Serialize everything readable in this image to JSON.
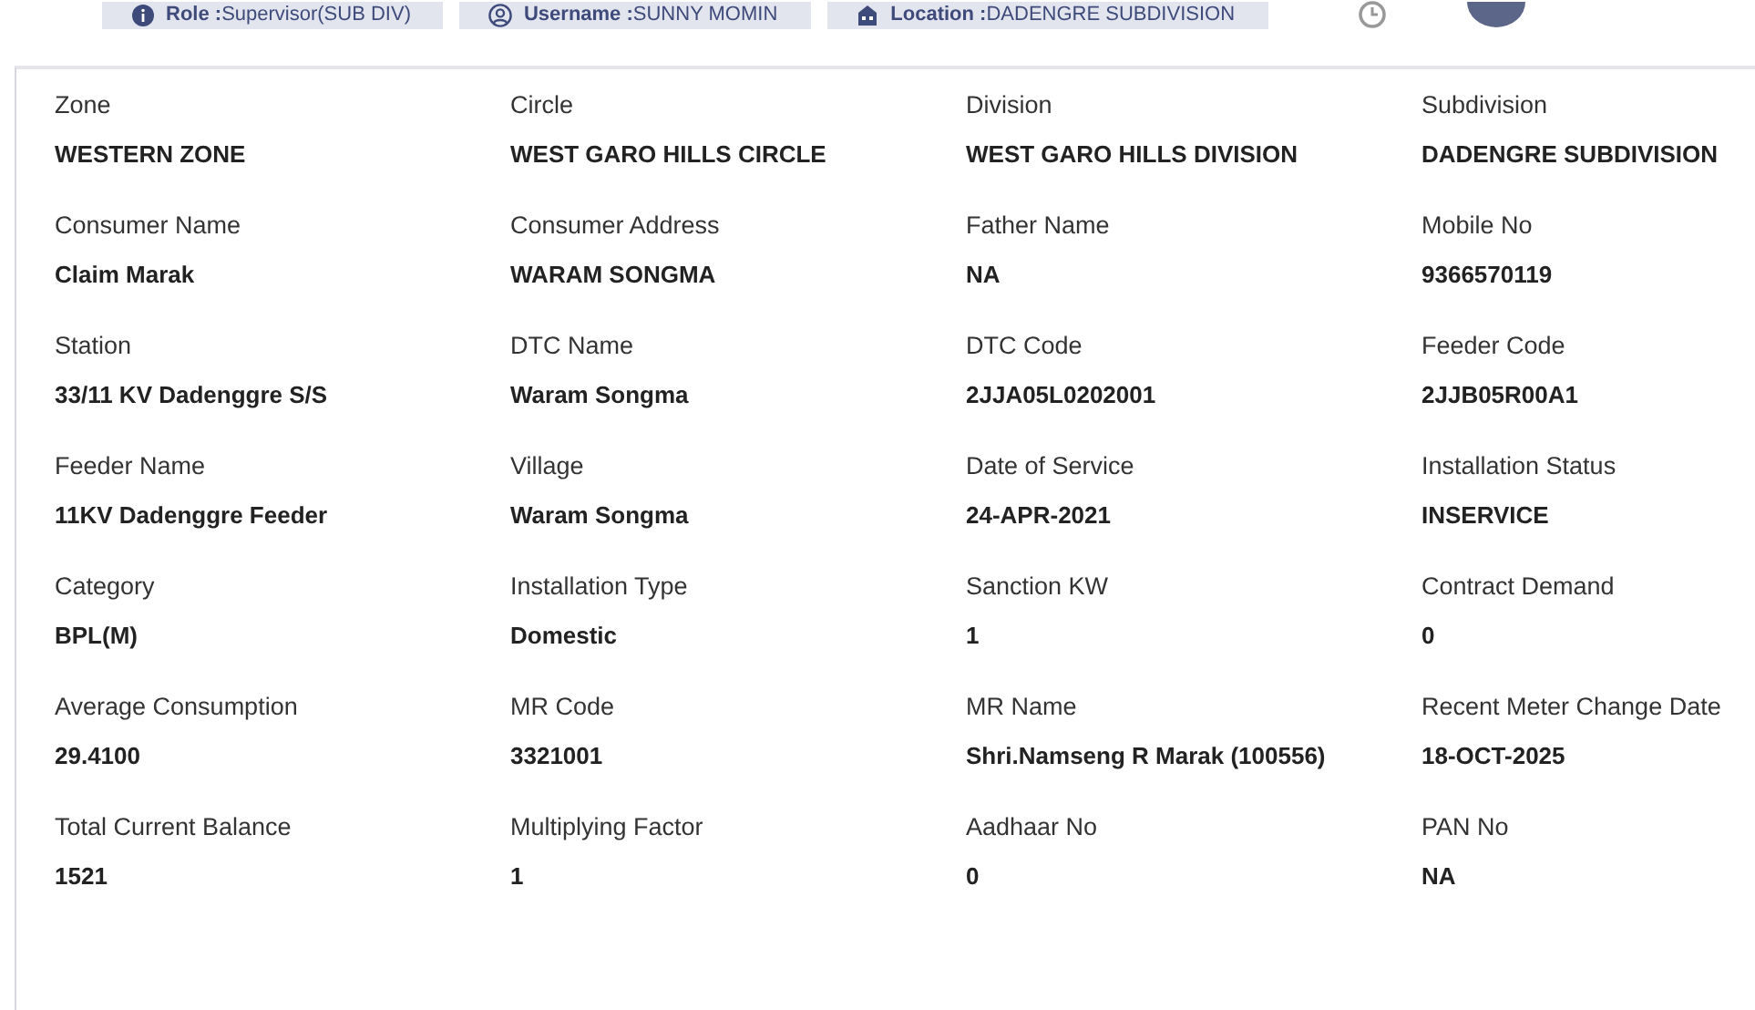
{
  "header": {
    "chips": [
      {
        "kind": "role",
        "label": "Role :",
        "value": "Supervisor(SUB DIV)"
      },
      {
        "kind": "user",
        "label": "Username :",
        "value": "SUNNY MOMIN"
      },
      {
        "kind": "location",
        "label": "Location :",
        "value": "DADENGRE SUBDIVISION"
      }
    ]
  },
  "fields": [
    {
      "label": "Zone",
      "value": "WESTERN ZONE"
    },
    {
      "label": "Circle",
      "value": "WEST GARO HILLS CIRCLE"
    },
    {
      "label": "Division",
      "value": "WEST GARO HILLS DIVISION"
    },
    {
      "label": "Subdivision",
      "value": "DADENGRE SUBDIVISION"
    },
    {
      "label": "Consumer Name",
      "value": "Claim Marak"
    },
    {
      "label": "Consumer Address",
      "value": "WARAM SONGMA"
    },
    {
      "label": "Father Name",
      "value": "NA"
    },
    {
      "label": "Mobile No",
      "value": "9366570119"
    },
    {
      "label": "Station",
      "value": "33/11 KV Dadenggre S/S"
    },
    {
      "label": "DTC Name",
      "value": "Waram Songma"
    },
    {
      "label": "DTC Code",
      "value": "2JJA05L0202001"
    },
    {
      "label": "Feeder Code",
      "value": "2JJB05R00A1"
    },
    {
      "label": "Feeder Name",
      "value": "11KV Dadenggre Feeder"
    },
    {
      "label": "Village",
      "value": "Waram Songma"
    },
    {
      "label": "Date of Service",
      "value": "24-APR-2021"
    },
    {
      "label": "Installation Status",
      "value": "INSERVICE"
    },
    {
      "label": "Category",
      "value": "BPL(M)"
    },
    {
      "label": "Installation Type",
      "value": "Domestic"
    },
    {
      "label": "Sanction KW",
      "value": "1"
    },
    {
      "label": "Contract Demand",
      "value": "0"
    },
    {
      "label": "Average Consumption",
      "value": "29.4100"
    },
    {
      "label": "MR Code",
      "value": "3321001"
    },
    {
      "label": "MR Name",
      "value": "Shri.Namseng R Marak (100556)"
    },
    {
      "label": "Recent Meter Change Date",
      "value": "18-OCT-2025"
    },
    {
      "label": "Total Current Balance",
      "value": "1521"
    },
    {
      "label": "Multiplying Factor",
      "value": "1"
    },
    {
      "label": "Aadhaar No",
      "value": "0"
    },
    {
      "label": "PAN No",
      "value": "NA"
    }
  ]
}
